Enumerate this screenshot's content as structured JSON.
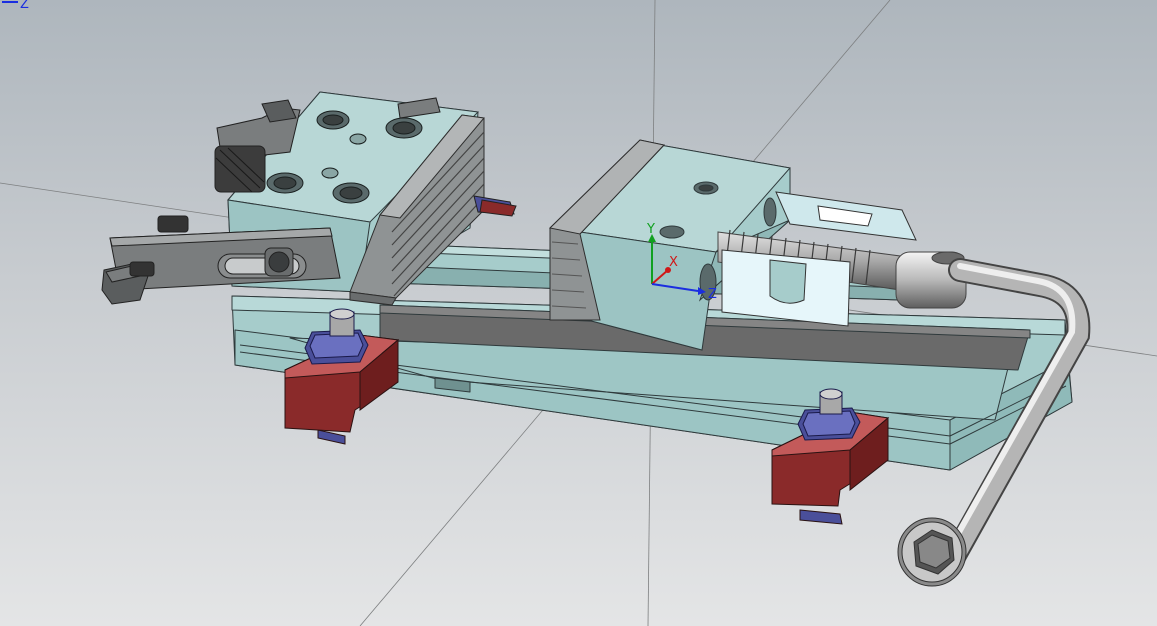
{
  "viewport": {
    "corner_triad_label": "Z",
    "model_triad": {
      "x_label": "X",
      "y_label": "Y",
      "z_label": "Z"
    }
  },
  "colors": {
    "background_top": "#aeb6bd",
    "background_bottom": "#e4e5e6",
    "vise_body": "#a6cccb",
    "vise_edge": "#2f3a3c",
    "clamp_red": "#8a2a2a",
    "nut_blue": "#4a4f9a",
    "jaw_gray": "#8f9394",
    "axis_x": "#d01818",
    "axis_y": "#10a020",
    "axis_z": "#1a2ee0"
  }
}
